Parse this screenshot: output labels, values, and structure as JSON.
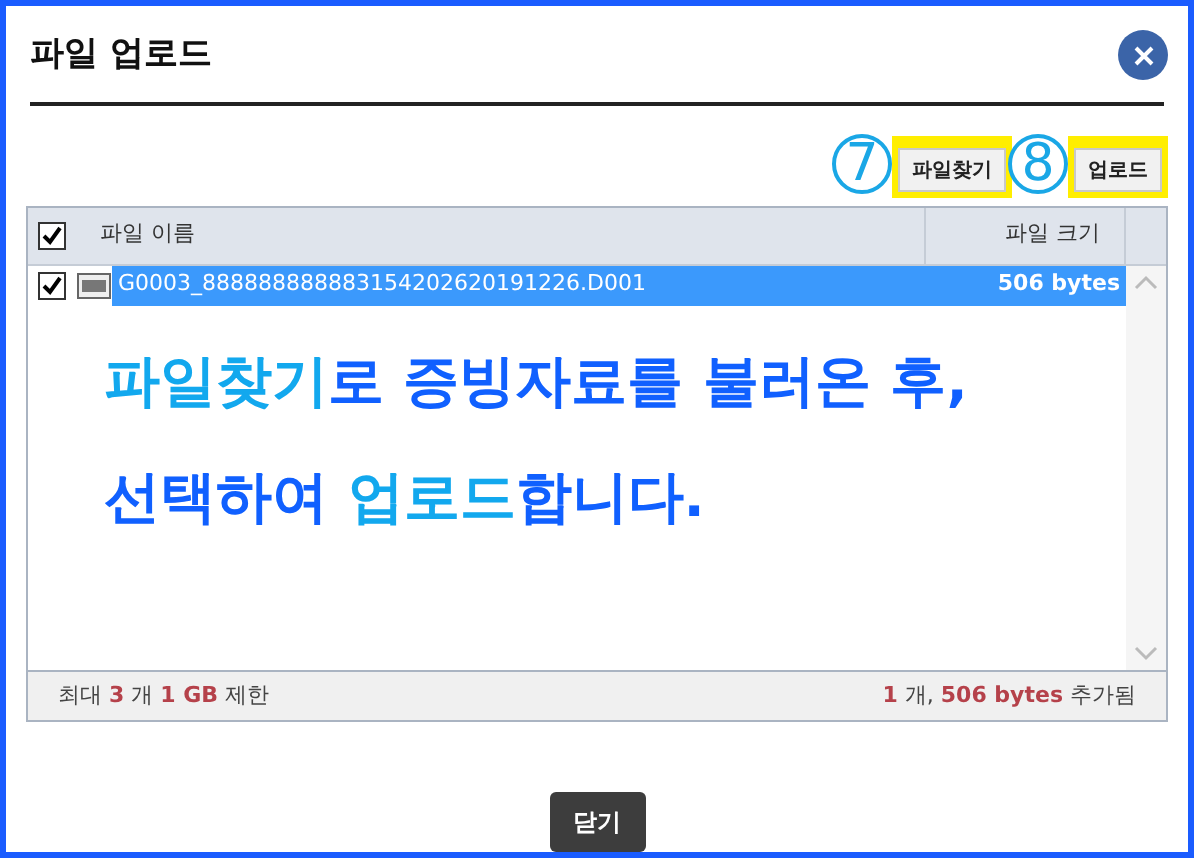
{
  "dialog": {
    "title": "파일 업로드"
  },
  "toolbar": {
    "buttons": [
      {
        "label": "파일찾기",
        "callout": "7",
        "highlighted": true
      },
      {
        "label": "업로드",
        "callout": "8",
        "highlighted": true
      }
    ]
  },
  "table": {
    "all_checked": true,
    "columns": [
      "파일 이름",
      "파일 크기"
    ],
    "rows": [
      {
        "name": "G0003_888888888883154202620191226.D001",
        "size": "506 bytes",
        "checked": true,
        "selected": true
      }
    ]
  },
  "annotation": {
    "lines": [
      [
        {
          "text": "파일찾기",
          "highlight": true
        },
        {
          "text": "로 증빙자료를 불러온 후,",
          "highlight": false
        }
      ],
      [
        {
          "text": "선택하여 ",
          "highlight": false
        },
        {
          "text": "업로드",
          "highlight": true
        },
        {
          "text": "합니다.",
          "highlight": false
        }
      ]
    ]
  },
  "footer": {
    "limit": "최대 **3** 개 **1 GB** 제한",
    "added": "**1** 개, **506 bytes** 추가됨"
  },
  "close_button": "닫기"
}
